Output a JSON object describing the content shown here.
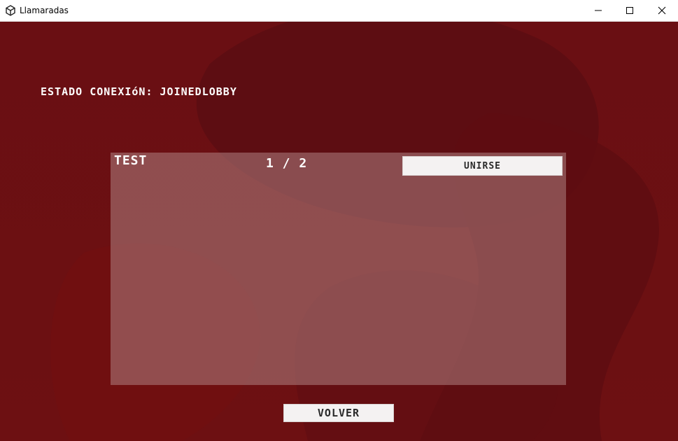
{
  "window": {
    "title": "Llamaradas"
  },
  "status": {
    "text": "ESTADO CONEXIóN: JOINEDLOBBY"
  },
  "room": {
    "name": "TEST",
    "players": "1 / 2",
    "join_label": "UNIRSE"
  },
  "actions": {
    "back_label": "VOLVER"
  },
  "colors": {
    "background": "#6a0f12",
    "panel": "#8d6060",
    "button": "#f4f2f2"
  },
  "icons": {
    "app": "unity-logo-icon",
    "minimize": "minimize-icon",
    "maximize": "maximize-icon",
    "close": "close-icon"
  }
}
